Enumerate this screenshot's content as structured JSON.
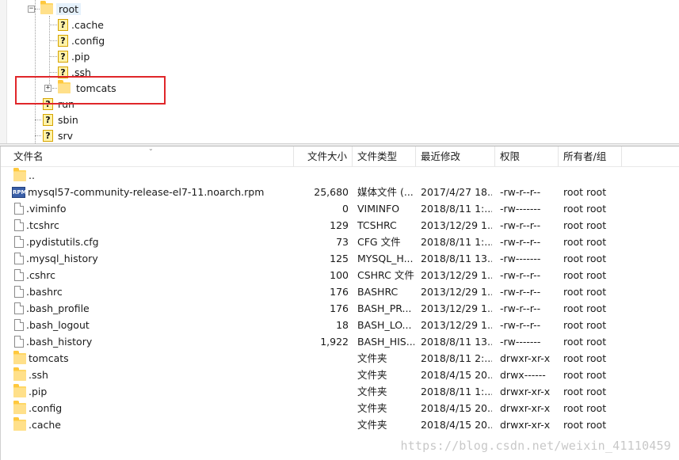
{
  "tree": {
    "items": [
      {
        "label": "root",
        "icon": "folder-icon",
        "expanded": true,
        "selected": true
      },
      {
        "label": ".cache",
        "icon": "unknown-folder-icon"
      },
      {
        "label": ".config",
        "icon": "unknown-folder-icon"
      },
      {
        "label": ".pip",
        "icon": "unknown-folder-icon"
      },
      {
        "label": ".ssh",
        "icon": "unknown-folder-icon"
      },
      {
        "label": "tomcats",
        "icon": "folder-icon",
        "expander": "+"
      },
      {
        "label": "run",
        "icon": "unknown-folder-icon"
      },
      {
        "label": "sbin",
        "icon": "unknown-folder-icon"
      },
      {
        "label": "srv",
        "icon": "unknown-folder-icon"
      }
    ],
    "highlight_color": "#e0262a"
  },
  "columns": {
    "name": "文件名",
    "size": "文件大小",
    "type": "文件类型",
    "modified": "最近修改",
    "perm": "权限",
    "owner": "所有者/组"
  },
  "files": [
    {
      "name": "..",
      "size": "",
      "type": "",
      "modified": "",
      "perm": "",
      "owner": "",
      "icon": "folder-icon"
    },
    {
      "name": "mysql57-community-release-el7-11.noarch.rpm",
      "size": "25,680",
      "type": "媒体文件 (...",
      "modified": "2017/4/27 18...",
      "perm": "-rw-r--r--",
      "owner": "root root",
      "icon": "rpm-icon"
    },
    {
      "name": ".viminfo",
      "size": "0",
      "type": "VIMINFO",
      "modified": "2018/8/11 1:...",
      "perm": "-rw-------",
      "owner": "root root",
      "icon": "file-icon"
    },
    {
      "name": ".tcshrc",
      "size": "129",
      "type": "TCSHRC",
      "modified": "2013/12/29 1...",
      "perm": "-rw-r--r--",
      "owner": "root root",
      "icon": "file-icon"
    },
    {
      "name": ".pydistutils.cfg",
      "size": "73",
      "type": "CFG 文件",
      "modified": "2018/8/11 1:...",
      "perm": "-rw-r--r--",
      "owner": "root root",
      "icon": "file-icon"
    },
    {
      "name": ".mysql_history",
      "size": "125",
      "type": "MYSQL_H...",
      "modified": "2018/8/11 13...",
      "perm": "-rw-------",
      "owner": "root root",
      "icon": "file-icon"
    },
    {
      "name": ".cshrc",
      "size": "100",
      "type": "CSHRC 文件",
      "modified": "2013/12/29 1...",
      "perm": "-rw-r--r--",
      "owner": "root root",
      "icon": "file-icon"
    },
    {
      "name": ".bashrc",
      "size": "176",
      "type": "BASHRC",
      "modified": "2013/12/29 1...",
      "perm": "-rw-r--r--",
      "owner": "root root",
      "icon": "file-icon"
    },
    {
      "name": ".bash_profile",
      "size": "176",
      "type": "BASH_PR...",
      "modified": "2013/12/29 1...",
      "perm": "-rw-r--r--",
      "owner": "root root",
      "icon": "file-icon"
    },
    {
      "name": ".bash_logout",
      "size": "18",
      "type": "BASH_LO...",
      "modified": "2013/12/29 1...",
      "perm": "-rw-r--r--",
      "owner": "root root",
      "icon": "file-icon"
    },
    {
      "name": ".bash_history",
      "size": "1,922",
      "type": "BASH_HIS...",
      "modified": "2018/8/11 13...",
      "perm": "-rw-------",
      "owner": "root root",
      "icon": "file-icon"
    },
    {
      "name": "tomcats",
      "size": "",
      "type": "文件夹",
      "modified": "2018/8/11 2:...",
      "perm": "drwxr-xr-x",
      "owner": "root root",
      "icon": "folder-icon"
    },
    {
      "name": ".ssh",
      "size": "",
      "type": "文件夹",
      "modified": "2018/4/15 20...",
      "perm": "drwx------",
      "owner": "root root",
      "icon": "folder-icon"
    },
    {
      "name": ".pip",
      "size": "",
      "type": "文件夹",
      "modified": "2018/8/11 1:...",
      "perm": "drwxr-xr-x",
      "owner": "root root",
      "icon": "folder-icon"
    },
    {
      "name": ".config",
      "size": "",
      "type": "文件夹",
      "modified": "2018/4/15 20...",
      "perm": "drwxr-xr-x",
      "owner": "root root",
      "icon": "folder-icon"
    },
    {
      "name": ".cache",
      "size": "",
      "type": "文件夹",
      "modified": "2018/4/15 20...",
      "perm": "drwxr-xr-x",
      "owner": "root root",
      "icon": "folder-icon"
    }
  ],
  "watermark": "https://blog.csdn.net/weixin_41110459"
}
